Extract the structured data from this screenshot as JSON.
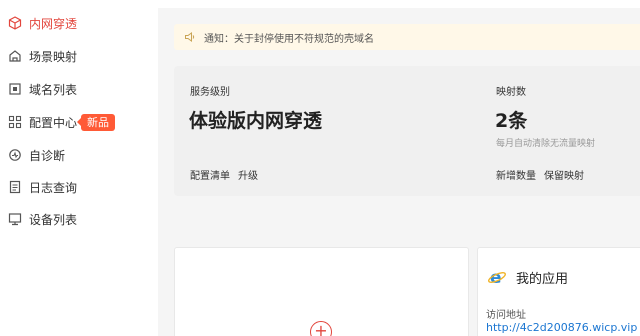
{
  "sidebar": {
    "items": [
      {
        "label": "内网穿透",
        "icon": "cube-icon",
        "active": true
      },
      {
        "label": "场景映射",
        "icon": "scene-icon"
      },
      {
        "label": "域名列表",
        "icon": "domain-list-icon"
      },
      {
        "label": "配置中心",
        "icon": "grid-icon",
        "badge": "新品"
      },
      {
        "label": "自诊断",
        "icon": "diagnose-icon"
      },
      {
        "label": "日志查询",
        "icon": "log-icon"
      },
      {
        "label": "设备列表",
        "icon": "device-icon"
      }
    ]
  },
  "notice": {
    "icon": "speaker-icon",
    "text": "通知：关于封停使用不符规范的壳域名"
  },
  "service": {
    "level_label": "服务级别",
    "level_value": "体验版内网穿透",
    "mapping_label": "映射数",
    "mapping_value": "2条",
    "mapping_hint": "每月自动清除无流量映射",
    "links_left": [
      "配置清单",
      "升级"
    ],
    "links_right": [
      "新增数量",
      "保留映射"
    ]
  },
  "apps": {
    "add_symbol": "+",
    "title": "我的应用",
    "icon": "ie-browser-icon",
    "address_label": "访问地址",
    "address_url": "http://4c2d200876.wicp.vip"
  },
  "colors": {
    "accent": "#e2453c",
    "badge": "#ff5a36",
    "link": "#1b76d1",
    "notice_bg": "#fff8e8"
  }
}
